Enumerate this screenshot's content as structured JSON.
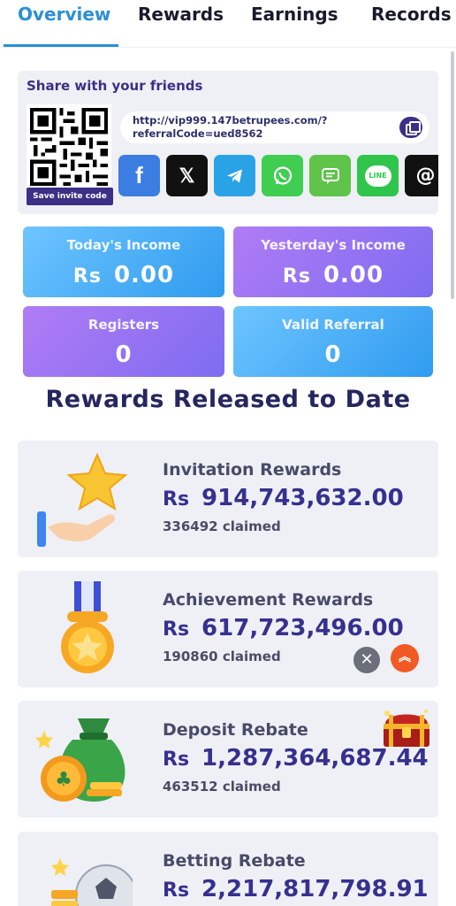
{
  "tabs": [
    {
      "label": "Overview",
      "active": true
    },
    {
      "label": "Rewards",
      "active": false
    },
    {
      "label": "Earnings",
      "active": false
    },
    {
      "label": "Records",
      "active": false
    }
  ],
  "share": {
    "title": "Share with your friends",
    "invite_button": "Save invite code",
    "link_line1": "http://vip999.147betrupees.com/?",
    "link_line2": "referralCode=ued8562",
    "socials": [
      {
        "name": "facebook",
        "icon": "facebook-icon",
        "color": "#3b7de0"
      },
      {
        "name": "x",
        "icon": "x-icon",
        "color": "#111111"
      },
      {
        "name": "telegram",
        "icon": "telegram-icon",
        "color": "#2aa3e6"
      },
      {
        "name": "whatsapp",
        "icon": "whatsapp-icon",
        "color": "#3fce52"
      },
      {
        "name": "sms",
        "icon": "message-icon",
        "color": "#5fc44a"
      },
      {
        "name": "line",
        "icon": "line-icon",
        "color": "#2fc54a"
      },
      {
        "name": "threads",
        "icon": "threads-icon",
        "color": "#111111"
      }
    ]
  },
  "stats": {
    "currency": "Rs",
    "today_label": "Today's Income",
    "today_value": "0.00",
    "yesterday_label": "Yesterday's Income",
    "yesterday_value": "0.00",
    "registers_label": "Registers",
    "registers_value": "0",
    "valid_label": "Valid Referral",
    "valid_value": "0"
  },
  "section_title": "Rewards Released to Date",
  "rewards": [
    {
      "title": "Invitation Rewards",
      "currency": "Rs",
      "amount": "914,743,632.00",
      "claimed": "336492 claimed",
      "icon": "star-hand-icon"
    },
    {
      "title": "Achievement Rewards",
      "currency": "Rs",
      "amount": "617,723,496.00",
      "claimed": "190860 claimed",
      "icon": "medal-icon"
    },
    {
      "title": "Deposit Rebate",
      "currency": "Rs",
      "amount": "1,287,364,687.44",
      "claimed": "463512 claimed",
      "icon": "money-bag-icon"
    },
    {
      "title": "Betting Rebate",
      "currency": "Rs",
      "amount": "2,217,817,798.91",
      "claimed": "",
      "icon": "football-coins-icon"
    }
  ],
  "floating": {
    "close": "✕",
    "up": "︽"
  },
  "colors": {
    "accent": "#2b8fd6",
    "primary": "#3b2f86",
    "card_bg": "#eef0f5"
  }
}
